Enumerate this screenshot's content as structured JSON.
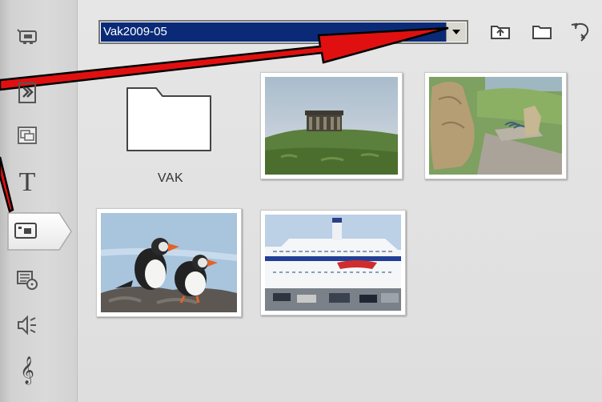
{
  "browser": {
    "folder": "Vak2009-05",
    "toolbar": [
      "folder-up-icon",
      "folder-icon",
      "rotate-icon"
    ]
  },
  "sidebar": {
    "tools": [
      {
        "icon": "video-capture-icon",
        "selected": false
      },
      {
        "icon": "transition-icon",
        "selected": false
      },
      {
        "icon": "overlay-icon",
        "selected": false
      },
      {
        "icon": "title-icon",
        "glyph": "T",
        "selected": false
      },
      {
        "icon": "photo-camera-icon",
        "selected": true
      },
      {
        "icon": "disc-menu-icon",
        "selected": false
      },
      {
        "icon": "sound-effects-icon",
        "selected": false
      },
      {
        "icon": "music-icon",
        "glyph": "𝄞",
        "selected": false
      }
    ]
  },
  "items": {
    "folder": {
      "label": "VAK",
      "icon": "folder-icon"
    },
    "thumbnails": [
      "monument-on-hill-photo",
      "carved-stone-photo",
      "puffins-photo",
      "ferry-ship-photo"
    ]
  },
  "colors": {
    "selection": "#0a2a78",
    "annotation_arrow": "#e01010"
  }
}
